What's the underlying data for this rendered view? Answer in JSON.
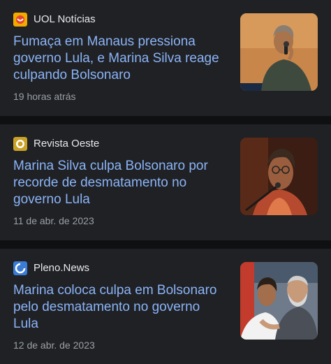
{
  "articles": [
    {
      "source": "UOL Notícias",
      "source_icon": "uol-logo-icon",
      "source_color": "#f2a900",
      "headline": "Fumaça em Manaus pressiona governo Lula, e Marina Silva reage culpando Bolsonaro",
      "time": "19 horas atrás",
      "thumbnail": "photo-woman-speaking-microphone"
    },
    {
      "source": "Revista Oeste",
      "source_icon": "revista-oeste-logo-icon",
      "source_color": "#c9a227",
      "headline": "Marina Silva culpa Bolsonaro por recorde de desmatamento no governo Lula",
      "time": "11 de abr. de 2023",
      "thumbnail": "photo-woman-glasses-microphone"
    },
    {
      "source": "Pleno.News",
      "source_icon": "pleno-news-logo-icon",
      "source_color": "#3a7bd5",
      "headline": "Marina coloca culpa em Bolsonaro pelo desmatamento no governo Lula",
      "time": "12 de abr. de 2023",
      "thumbnail": "photo-two-people-event"
    }
  ],
  "colors": {
    "background": "#0f1011",
    "card": "#202124",
    "headline": "#8ab4f8",
    "source_text": "#e8eaed",
    "time_text": "#9aa0a6"
  }
}
